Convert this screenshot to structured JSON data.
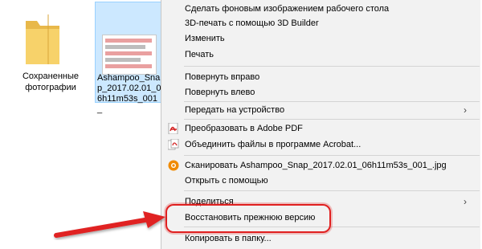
{
  "desktop": {
    "folder_label": "Сохраненные фотографии",
    "file_label": "Ashampoo_Snap_2017.02.01_06h11m53s_001_"
  },
  "menu": {
    "items": [
      {
        "label": "Сделать фоновым изображением рабочего стола"
      },
      {
        "label": "3D-печать с помощью 3D Builder"
      },
      {
        "label": "Изменить"
      },
      {
        "label": "Печать"
      },
      {
        "label": "Повернуть вправо"
      },
      {
        "label": "Повернуть влево"
      },
      {
        "label": "Передать на устройство",
        "submenu": true
      },
      {
        "label": "Преобразовать в Adobe PDF",
        "icon": "adobe-pdf-icon"
      },
      {
        "label": "Объединить файлы в программе Acrobat...",
        "icon": "acrobat-combine-icon"
      },
      {
        "label": "Сканировать Ashampoo_Snap_2017.02.01_06h11m53s_001_.jpg",
        "icon": "avast-scan-icon"
      },
      {
        "label": "Открыть с помощью",
        "submenu": true
      },
      {
        "label": "Поделиться",
        "submenu": true
      },
      {
        "label": "Восстановить прежнюю версию"
      },
      {
        "label": "Копировать в папку..."
      }
    ],
    "submenu_glyph": "›"
  },
  "colors": {
    "selection": "#cce8ff",
    "highlight_border": "#e02020",
    "menu_bg": "#f2f2f2"
  }
}
